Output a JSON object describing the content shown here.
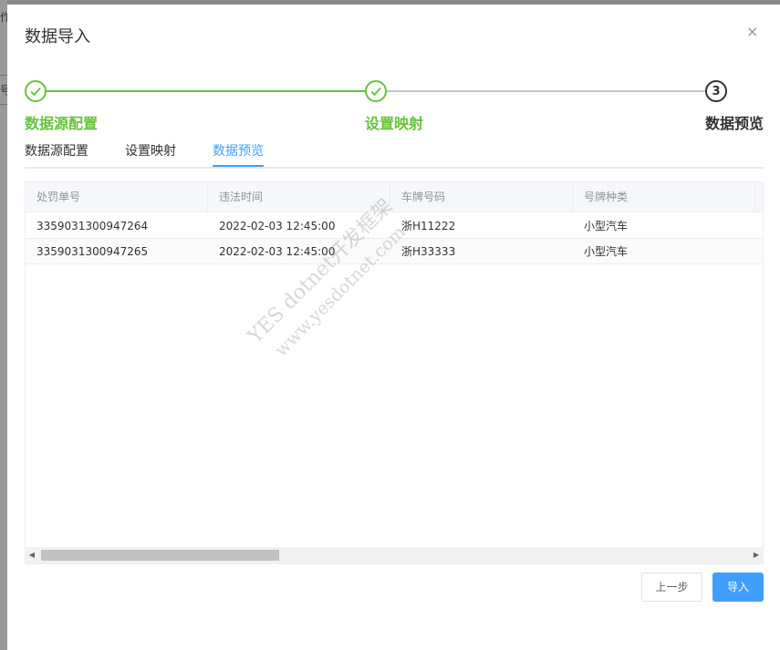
{
  "backdrop": {
    "chars": [
      "作",
      "号"
    ]
  },
  "dialog": {
    "title": "数据导入",
    "close_icon": "×"
  },
  "steps": [
    {
      "title": "数据源配置",
      "status": "success",
      "icon": "check-icon"
    },
    {
      "title": "设置映射",
      "status": "success",
      "icon": "check-icon"
    },
    {
      "title": "数据预览",
      "status": "process",
      "number": "3"
    }
  ],
  "tabs": [
    {
      "label": "数据源配置",
      "active": false
    },
    {
      "label": "设置映射",
      "active": false
    },
    {
      "label": "数据预览",
      "active": true
    }
  ],
  "table": {
    "columns": [
      "处罚单号",
      "违法时间",
      "车牌号码",
      "号牌种类"
    ],
    "rows": [
      [
        "3359031300947264",
        "2022-02-03 12:45:00",
        "浙H11222",
        "小型汽车"
      ],
      [
        "3359031300947265",
        "2022-02-03 12:45:00",
        "浙H33333",
        "小型汽车"
      ]
    ]
  },
  "scrollbar": {
    "left_arrow": "◀",
    "right_arrow": "▶",
    "position": 0.0
  },
  "buttons": {
    "prev_label": "上一步",
    "import_label": "导入"
  },
  "watermark": {
    "line1": "YES dotnet开发框架",
    "line2": "www.yesdotnet.com"
  },
  "colors": {
    "success": "#67c23a",
    "primary": "#409eff",
    "text": "#303133",
    "muted": "#909399"
  }
}
